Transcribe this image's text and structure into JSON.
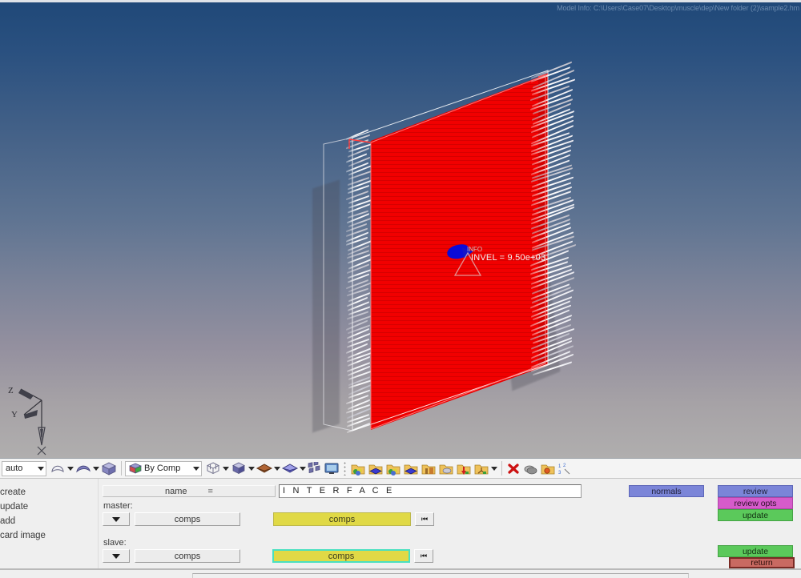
{
  "viewport": {
    "model_info": "Model Info: C:\\Users\\Case07\\Desktop\\muscle\\dep\\New folder (2)\\sample2.hm",
    "annotation_small": "INFO",
    "annotation": "INVEL = 9.50e+03",
    "axes": {
      "x": "X",
      "y": "Y",
      "z": "Z"
    },
    "colors": {
      "plate": "#f10000",
      "normals": "#ffffff",
      "marker": "#0b0bd8",
      "bg_top": "#1f4878",
      "bg_bottom": "#b0aeae"
    }
  },
  "toolbar": {
    "mode_value": "auto",
    "by_comp_value": "By Comp",
    "icons": [
      "surface-patch-icon",
      "surface-shaded-icon",
      "solid-cube-icon",
      "color-by-comp-icon",
      "wireframe-cube-icon",
      "shaded-cube-icon",
      "2d-elements-icon",
      "3d-elements-icon",
      "mesh-fragments-icon",
      "display-monitor-icon",
      "component-colors-icon",
      "component-blue-icon",
      "folder-props-icon",
      "folder-mat-icon",
      "folder-load-icon",
      "folder-assembly-icon",
      "delete-red-x-icon",
      "mask-layers-icon",
      "find-folder-icon",
      "numbering-123-icon"
    ]
  },
  "panel": {
    "left_menu": [
      {
        "label": "create"
      },
      {
        "label": "update"
      },
      {
        "label": "add"
      },
      {
        "label": "card image"
      }
    ],
    "name_label": "name",
    "name_equals": "=",
    "name_value": "I N T E R F A C E",
    "master": {
      "title": "master:",
      "entity_button": "comps",
      "selector_button": "comps",
      "rewind": "⏮"
    },
    "slave": {
      "title": "slave:",
      "entity_button": "comps",
      "selector_button": "comps",
      "rewind": "⏮"
    },
    "normals_button": "normals",
    "review_button": "review",
    "review_opts_button": "review opts",
    "update_button_top": "update",
    "update_button_bottom": "update",
    "return_button": "return"
  }
}
